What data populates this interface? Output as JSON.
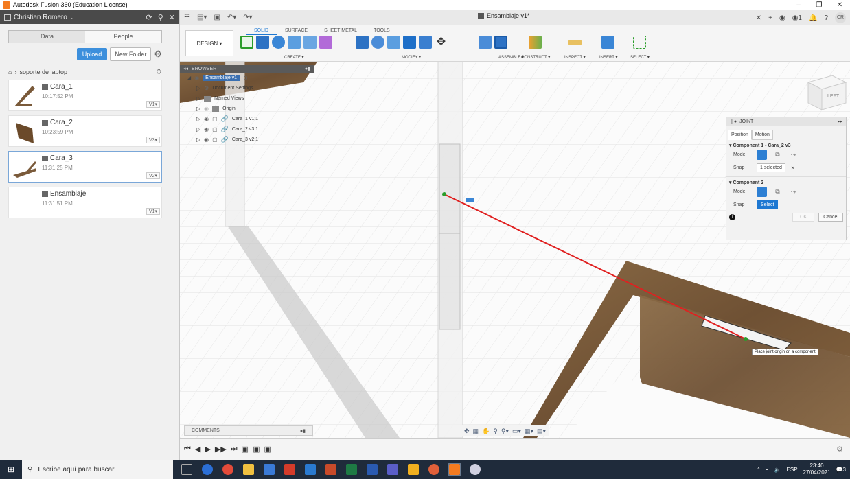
{
  "window": {
    "title": "Autodesk Fusion 360 (Education License)",
    "minimize": "–",
    "restore": "❐",
    "close": "✕"
  },
  "datapanel": {
    "user": "Christian Romero",
    "tabs": [
      "Data",
      "People"
    ],
    "upload": "Upload",
    "new_folder": "New Folder",
    "breadcrumb": "soporte de laptop",
    "files": [
      {
        "name": "Cara_1",
        "time": "10:17:52 PM",
        "version": "V1▾"
      },
      {
        "name": "Cara_2",
        "time": "10:23:59 PM",
        "version": "V3▾"
      },
      {
        "name": "Cara_3",
        "time": "11:31:25 PM",
        "version": "V2▾"
      },
      {
        "name": "Ensamblaje",
        "time": "11:31:51 PM",
        "version": "V1▾"
      }
    ]
  },
  "appbar": {
    "doc_title": "Ensamblaje v1*"
  },
  "toolbar": {
    "design": "DESIGN ▾",
    "tabs": [
      "SOLID",
      "SURFACE",
      "SHEET METAL",
      "TOOLS"
    ],
    "groups": [
      "CREATE ▾",
      "MODIFY ▾",
      "ASSEMBLE ▾",
      "CONSTRUCT ▾",
      "INSPECT ▾",
      "INSERT ▾",
      "SELECT ▾"
    ]
  },
  "browser": {
    "title": "BROWSER",
    "root": "Ensamblaje v1",
    "items": [
      "Document Settings",
      "Named Views",
      "Origin",
      "Cara_1 v1:1",
      "Cara_2 v3:1",
      "Cara_3 v2:1"
    ]
  },
  "joint": {
    "title": "JOINT",
    "tabs": [
      "Position",
      "Motion"
    ],
    "comp1": "▾ Component 1 - Cara_2 v3",
    "comp2": "▾ Component 2",
    "mode_label": "Mode",
    "snap_label": "Snap",
    "snap1": "1 selected",
    "snap2": "Select",
    "ok": "OK",
    "cancel": "Cancel"
  },
  "viewcube": {
    "face": "LEFT"
  },
  "tooltip": "Place joint origin on a component",
  "comments": "COMMENTS",
  "taskbar": {
    "search_placeholder": "Escribe aquí para buscar",
    "lang": "ESP",
    "time": "23:40",
    "date": "27/04/2021",
    "notif": "3"
  },
  "colors": {
    "accent": "#1e78d2",
    "wood": "#7a5a3a",
    "red_line": "#e02020"
  }
}
